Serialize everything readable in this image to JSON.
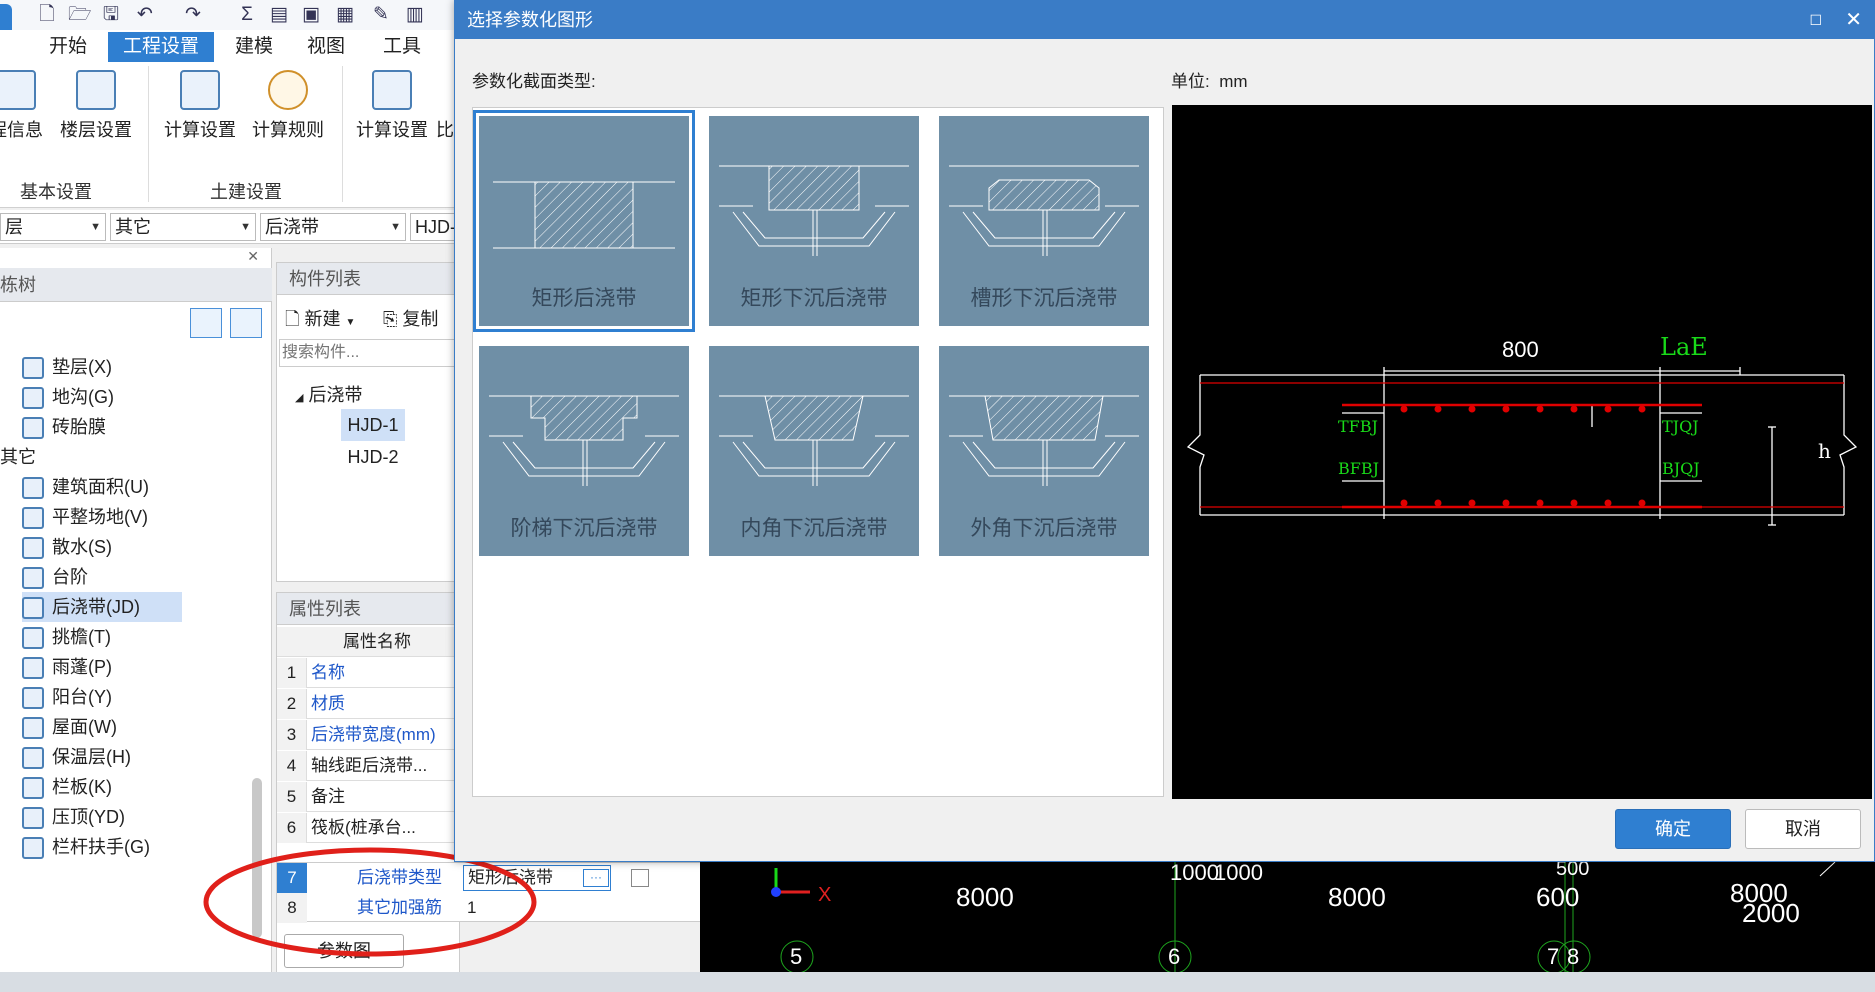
{
  "ribbon": {
    "tabs": [
      "开始",
      "工程设置",
      "建模",
      "视图",
      "工具"
    ],
    "active_tab": "工程设置",
    "buttons": [
      "程信息",
      "楼层设置",
      "计算设置",
      "计算规则",
      "计算设置",
      "比"
    ],
    "groups": [
      "基本设置",
      "土建设置"
    ]
  },
  "dropdowns": [
    "层",
    "其它",
    "后浇带",
    "HJD-"
  ],
  "tree": {
    "header": "栋树",
    "items": [
      {
        "label": "垫层(X)",
        "icon": "cushion-icon"
      },
      {
        "label": "地沟(G)",
        "icon": "trench-icon"
      },
      {
        "label": "砖胎膜",
        "icon": "brick-mold-icon"
      },
      {
        "label": "其它",
        "icon": ""
      },
      {
        "label": "建筑面积(U)",
        "icon": "area-icon"
      },
      {
        "label": "平整场地(V)",
        "icon": "leveling-icon"
      },
      {
        "label": "散水(S)",
        "icon": "apron-icon"
      },
      {
        "label": "台阶",
        "icon": "steps-icon"
      },
      {
        "label": "后浇带(JD)",
        "icon": "post-pour-icon",
        "selected": true
      },
      {
        "label": "挑檐(T)",
        "icon": "eave-icon"
      },
      {
        "label": "雨蓬(P)",
        "icon": "canopy-icon"
      },
      {
        "label": "阳台(Y)",
        "icon": "balcony-icon"
      },
      {
        "label": "屋面(W)",
        "icon": "roof-icon"
      },
      {
        "label": "保温层(H)",
        "icon": "insulation-icon"
      },
      {
        "label": "栏板(K)",
        "icon": "parapet-icon"
      },
      {
        "label": "压顶(YD)",
        "icon": "coping-icon"
      },
      {
        "label": "栏杆扶手(G)",
        "icon": "railing-icon"
      }
    ]
  },
  "component_list": {
    "title": "构件列表",
    "new_label": "新建",
    "copy_label": "复制",
    "search_placeholder": "搜索构件...",
    "group": "后浇带",
    "items": [
      "HJD-1",
      "HJD-2"
    ]
  },
  "property_list": {
    "title": "属性列表",
    "column": "属性名称",
    "rows": [
      {
        "no": "1",
        "name": "名称"
      },
      {
        "no": "2",
        "name": "材质"
      },
      {
        "no": "3",
        "name": "后浇带宽度(mm)"
      },
      {
        "no": "4",
        "name": "轴线距后浇带..."
      },
      {
        "no": "5",
        "name": "备注"
      },
      {
        "no": "6",
        "name": "筏板(桩承台..."
      },
      {
        "no": "7",
        "name": "后浇带类型",
        "value": "矩形后浇带"
      },
      {
        "no": "8",
        "name": "其它加强筋",
        "value": "1"
      }
    ],
    "param_button": "参数图"
  },
  "dialog": {
    "title": "选择参数化图形",
    "section_label": "参数化截面类型:",
    "unit_label": "单位:",
    "unit_value": "mm",
    "shapes": [
      "矩形后浇带",
      "矩形下沉后浇带",
      "槽形下沉后浇带",
      "阶梯下沉后浇带",
      "内角下沉后浇带",
      "外角下沉后浇带"
    ],
    "selected_shape": "矩形后浇带",
    "preview": {
      "dim_width": "800",
      "dim_lae": "LaE",
      "label_tfbj": "TFBJ",
      "label_bfbj": "BFBJ",
      "label_tjqj": "TJQJ",
      "label_bjqj": "BJQJ",
      "label_h": "h"
    },
    "ok_label": "确定",
    "cancel_label": "取消"
  },
  "canvas": {
    "axis_x": "X",
    "dims": [
      "1000",
      "1000",
      "8000",
      "8000",
      "600",
      "8000",
      "2000",
      "500"
    ],
    "axis_numbers": [
      "5",
      "6",
      "7",
      "8"
    ]
  },
  "colors": {
    "accent": "#3a7cc6",
    "primary_button": "#2f7fd1",
    "canvas": "#000000",
    "rebar": "#e00000",
    "label_green": "#19d919"
  }
}
